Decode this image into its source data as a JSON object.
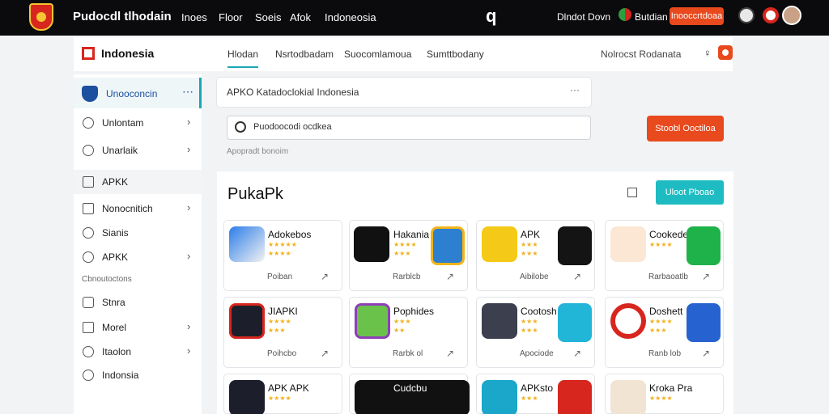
{
  "topbar": {
    "brand": "Pudocdl tlhodain",
    "nav": [
      "Inoes",
      "Floor",
      "Soeis",
      "Afok",
      "Indoneosia"
    ],
    "user": "Dlndot Dovn",
    "lang": "Butdian",
    "button": "Inooccrtdoaa"
  },
  "subbar": {
    "title": "Indonesia",
    "tabs": [
      "Hlodan",
      "Nsrtodbadam",
      "Suocomlamoua",
      "Sumttbodany"
    ],
    "right_text": "Nolrocst Rodanata"
  },
  "sidebar": {
    "header": "Unooconcin",
    "items": [
      {
        "label": "Unlontam",
        "chevron": true
      },
      {
        "label": "Unarlaik",
        "chevron": true
      },
      {
        "label": "APKK",
        "chevron": false
      },
      {
        "label": "Nonocnitich",
        "chevron": true
      },
      {
        "label": "Sianis",
        "chevron": false
      },
      {
        "label": "APKK",
        "chevron": true
      }
    ],
    "section": "Cbnoutoctons",
    "items2": [
      {
        "label": "Stnra",
        "chevron": false
      },
      {
        "label": "Morel",
        "chevron": true
      },
      {
        "label": "Itaolon",
        "chevron": true
      },
      {
        "label": "Indonsia",
        "chevron": false
      }
    ]
  },
  "main": {
    "breadcrumb": "APKO Katadoclokial Indonesia",
    "search_value": "Puodoocodi ocdkea",
    "search_hint": "Apopradt bonoim",
    "search_button": "Stoobl Ooctiloa",
    "panel_title": "PukaPk",
    "panel_button": "Uloot Pboao"
  },
  "cards": [
    {
      "name": "Adokebos",
      "tag": "Poiban"
    },
    {
      "name": "Hakania",
      "tag": "Rarblcb"
    },
    {
      "name": "APK",
      "tag": "Aibilobe"
    },
    {
      "name": "Cookede",
      "tag": "Rarbaoatlb"
    },
    {
      "name": "JIAPKI",
      "tag": "Poihcbo"
    },
    {
      "name": "Pophides",
      "tag": "Rarbk ol"
    },
    {
      "name": "Cootosh",
      "tag": "Apociode"
    },
    {
      "name": "Doshett",
      "tag": "Ranb lob"
    },
    {
      "name": "APK APK",
      "tag": ""
    },
    {
      "name": "Cudcbu",
      "tag": ""
    },
    {
      "name": "APKsto",
      "tag": ""
    },
    {
      "name": "Kroka Pra",
      "tag": ""
    }
  ],
  "colors": {
    "accent": "#1aa7b5",
    "primary_button": "#e8491d",
    "topbar": "#0b0b0d",
    "star": "#f2b01e"
  }
}
